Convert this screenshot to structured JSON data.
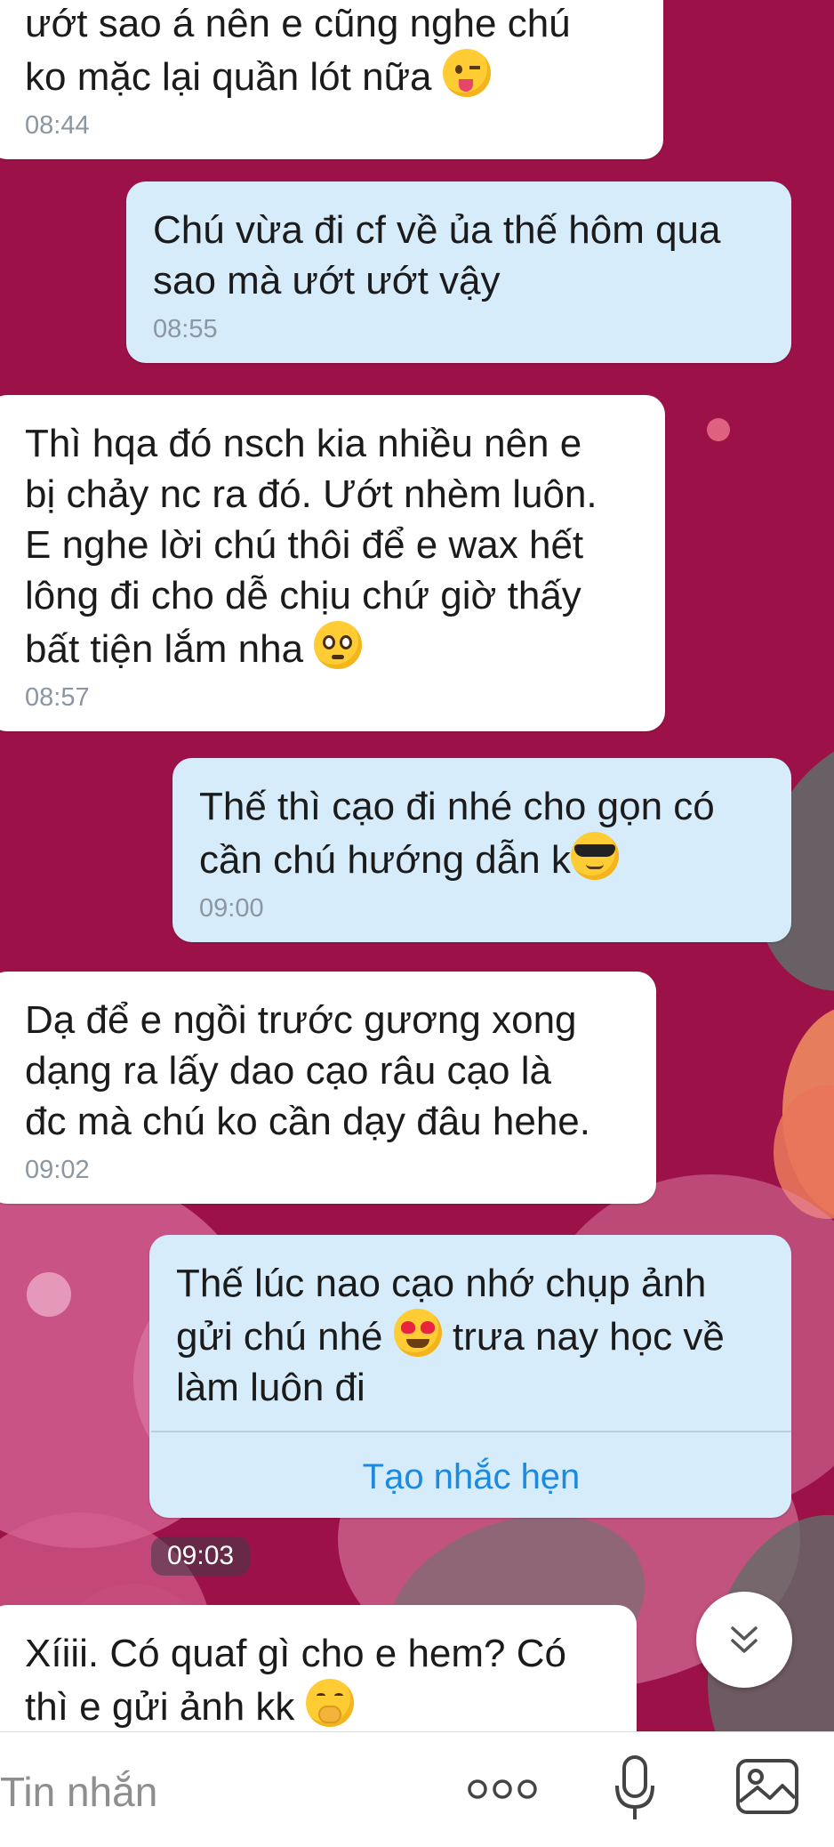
{
  "messages": [
    {
      "direction": "in",
      "lines": [
        "ướt sao á nên e cũng nghe chú",
        "ko mặc lại quần lót nữa"
      ],
      "emoji": "winking-tongue-emoji",
      "time": "08:44"
    },
    {
      "direction": "out",
      "lines": [
        "Chú vừa đi cf về ủa thế hôm qua",
        "sao mà ướt ướt vậy"
      ],
      "time": "08:55"
    },
    {
      "direction": "in",
      "lines": [
        "Thì hqa đó nsch kia nhiều nên e",
        "bị chảy nc ra đó. Ướt nhèm luôn.",
        "E nghe lời chú thôi để e wax hết",
        "lông đi cho dễ chịu chứ giờ thấy",
        "bất tiện lắm nha"
      ],
      "emoji": "pleading-face-emoji",
      "time": "08:57"
    },
    {
      "direction": "out",
      "lines": [
        "Thế thì cạo đi nhé cho gọn có",
        "cần chú hướng dẫn k"
      ],
      "emoji": "sunglasses-emoji",
      "time": "09:00"
    },
    {
      "direction": "in",
      "lines": [
        "Dạ để e ngồi trước gương xong",
        "dạng ra lấy dao cạo râu cạo là",
        "đc mà chú ko cần dạy đâu hehe."
      ],
      "time": "09:02"
    },
    {
      "direction": "out",
      "lines": [
        "Thế lúc nao cạo nhớ chụp ảnh",
        "gửi chú nhé",
        "trưa nay học về",
        "làm luôn đi"
      ],
      "emoji": "heart-eyes-emoji",
      "reminder": "Tạo nhắc hẹn"
    },
    {
      "direction": "in",
      "lines": [
        "Xíiii. Có quaf gì cho e hem? Có",
        "thì e gửi ảnh kk"
      ],
      "emoji": "hand-over-mouth-emoji"
    }
  ],
  "standalone_time": "09:03",
  "input": {
    "placeholder": "Tin nhắn"
  },
  "icons": {
    "more": "more-dots-icon",
    "mic": "microphone-icon",
    "gallery": "gallery-icon",
    "scroll": "chevron-down-icon"
  },
  "colors": {
    "background": "#9c1248",
    "incoming": "#ffffff",
    "outgoing": "#d6ecfb",
    "link": "#1b8ae0"
  }
}
